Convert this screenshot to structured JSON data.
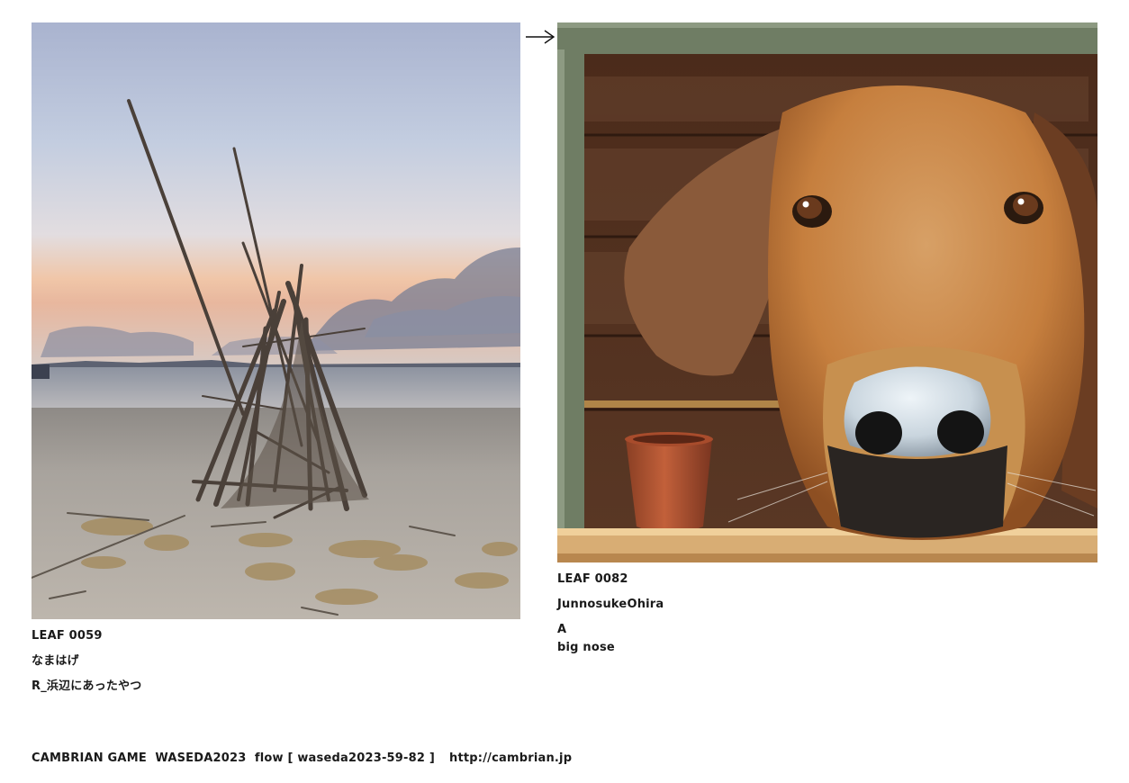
{
  "left_card": {
    "leaf_id": "LEAF 0059",
    "author": "なまはげ",
    "title": "R_浜辺にあったやつ"
  },
  "flow_arrow": {
    "icon": "arrow-right-icon"
  },
  "right_card": {
    "leaf_id": "LEAF 0082",
    "author": "JunnosukeOhira",
    "title_line1": "A",
    "title_line2": "big nose"
  },
  "footer": {
    "text": "CAMBRIAN GAME  WASEDA2023  flow [ waseda2023-59-82 ]",
    "url": "http://cambrian.jp"
  }
}
